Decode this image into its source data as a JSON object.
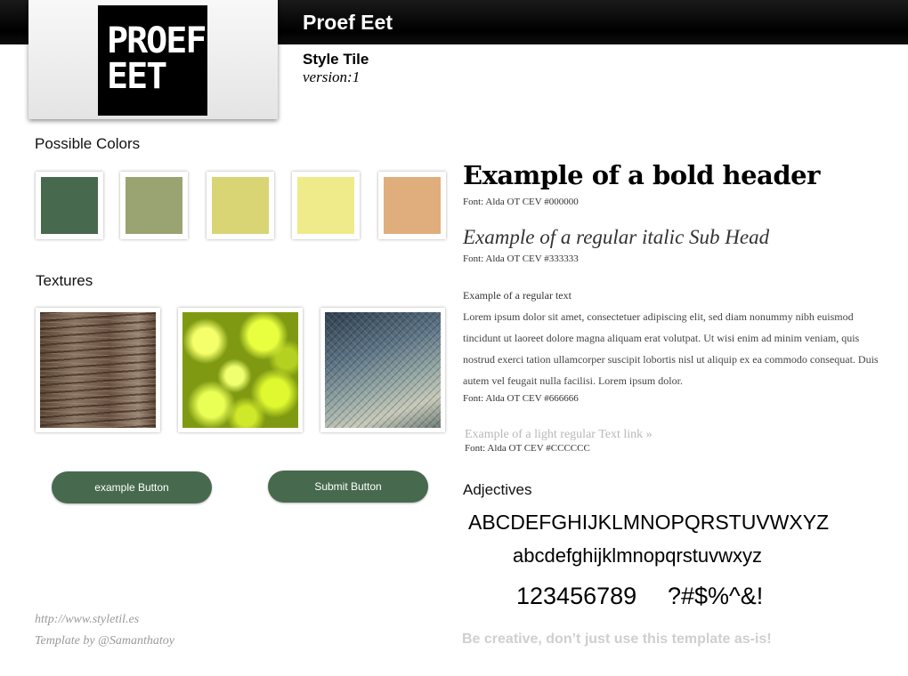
{
  "header": {
    "logo_line1": "PROEF",
    "logo_line2": "EET",
    "brand_title": "Proef Eet",
    "tile_label": "Style Tile",
    "version": "version:1"
  },
  "colors": {
    "title": "Possible Colors",
    "swatches": [
      "#476a4f",
      "#9aa472",
      "#d9d575",
      "#efeb8a",
      "#e0ae7c"
    ]
  },
  "textures": {
    "title": "Textures",
    "items": [
      "wood",
      "lettuce",
      "fish-skin"
    ]
  },
  "buttons": {
    "example_label": "example Button",
    "submit_label": "Submit Button"
  },
  "footer": {
    "site_link": "http://www.styletil.es",
    "credit": "Template by @Samanthatoy"
  },
  "typography": {
    "bold_header": "Example of a bold header",
    "bold_header_font": "Font: Alda OT CEV #000000",
    "subhead": "Example of a regular italic Sub Head",
    "subhead_font": "Font: Alda OT CEV #333333",
    "text_label": "Example of a regular text",
    "lorem": "Lorem ipsum dolor sit amet, consectetuer adipiscing elit, sed diam nonummy nibh euismod tincidunt ut laoreet dolore magna aliquam erat volutpat. Ut wisi enim ad minim veniam, quis nostrud exerci tation ullamcorper suscipit lobortis nisl ut aliquip ex ea commodo consequat. Duis autem vel feugait nulla facilisi. Lorem ipsum dolor.",
    "text_font": "Font: Alda OT CEV #666666",
    "link_text": "Example of a light regular Text link »",
    "link_font": "Font: Alda OT CEV #CCCCCC"
  },
  "adjectives": {
    "title": "Adjectives",
    "uppercase": "ABCDEFGHIJKLMNOPQRSTUVWXYZ",
    "lowercase": "abcdefghijklmnopqrstuvwxyz",
    "digits": "123456789",
    "symbols": "?#$%^&!",
    "tagline": "Be creative, don’t just use this template as-is!"
  }
}
